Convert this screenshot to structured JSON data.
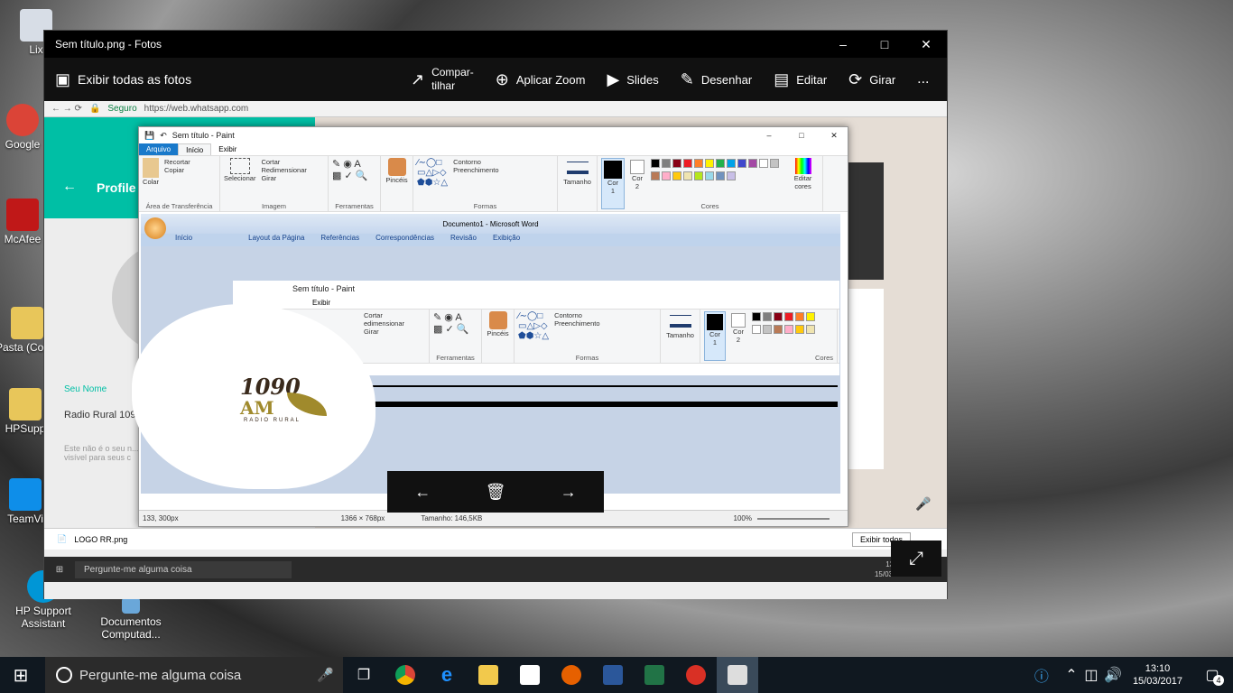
{
  "desktop": {
    "icons": [
      {
        "label": "Lix"
      },
      {
        "label": "Google"
      },
      {
        "label": "McAfee"
      },
      {
        "label": "Pasta (Comp"
      },
      {
        "label": "HPSupp"
      },
      {
        "label": "TeamVi"
      },
      {
        "label": "HP Support Assistant"
      },
      {
        "label": "Documentos Computad..."
      }
    ]
  },
  "photos": {
    "title": "Sem título.png - Fotos",
    "back_label": "Exibir todas as fotos",
    "tools": [
      {
        "label": "Compar-\ntilhar"
      },
      {
        "label": "Aplicar Zoom"
      },
      {
        "label": "Slides"
      },
      {
        "label": "Desenhar"
      },
      {
        "label": "Editar"
      },
      {
        "label": "Girar"
      }
    ],
    "more": "..."
  },
  "image": {
    "chrome": {
      "secure": "Seguro",
      "url": "https://web.whatsapp.com"
    },
    "whatsapp": {
      "header": "Profile",
      "name_label": "Seu Nome",
      "name_value": "Radio Rural 109",
      "note": "Este não é o seu n... visível para seus c"
    },
    "paint": {
      "title": "Sem título - Paint",
      "tabs": [
        "Arquivo",
        "Início",
        "Exibir"
      ],
      "groups": {
        "clipboard": {
          "paste": "Colar",
          "cut": "Recortar",
          "copy": "Copiar",
          "label": "Área de Transferência"
        },
        "image": {
          "select": "Selecionar",
          "crop": "Cortar",
          "resize": "Redimensionar",
          "rotate": "Girar",
          "label": "Imagem"
        },
        "tools": {
          "label": "Ferramentas"
        },
        "brushes": {
          "label": "Pincéis"
        },
        "shapes": {
          "outline": "Contorno",
          "fill": "Preenchimento",
          "label": "Formas"
        },
        "size": {
          "label": "Tamanho"
        },
        "colors": {
          "c1": "Cor\n1",
          "c2": "Cor\n2",
          "edit": "Editar cores",
          "label": "Cores"
        }
      },
      "status": {
        "pos": "133, 300px",
        "dims": "1366 × 768px",
        "size": "Tamanho: 146,5KB",
        "zoom": "100%"
      }
    },
    "word": {
      "title": "Documento1 - Microsoft Word",
      "tabs": [
        "Início",
        "Layout da Página",
        "Referências",
        "Correspondências",
        "Revisão",
        "Exibição"
      ]
    },
    "paint2": {
      "title": "Sem título - Paint",
      "tab": "Exibir",
      "tools_label": "Ferramentas",
      "brushes": "Pincéis",
      "shapes": "Formas",
      "outline": "Contorno",
      "fill": "Preenchimento",
      "size": "Tamanho",
      "c1": "Cor\n1",
      "c2": "Cor\n2",
      "colors": "Cores",
      "crop": "Cortar",
      "resize": "edimensionar",
      "rotate": "Girar"
    },
    "logo": {
      "big": "1090",
      "am": "AM",
      "sub": "RADIO RURAL"
    },
    "download": {
      "file": "LOGO RR.png",
      "show_all": "Exibir todos"
    },
    "inner_task": {
      "search": "Pergunte-me alguma coisa",
      "time": "13:0",
      "date": "15/03/2017"
    }
  },
  "taskbar": {
    "search": "Pergunte-me alguma coisa",
    "time": "13:10",
    "date": "15/03/2017",
    "notifications": "4"
  },
  "palette": [
    "#000000",
    "#7f7f7f",
    "#880015",
    "#ed1c24",
    "#ff7f27",
    "#fff200",
    "#22b14c",
    "#00a2e8",
    "#3f48cc",
    "#a349a4",
    "#ffffff",
    "#c3c3c3",
    "#b97a57",
    "#ffaec9",
    "#ffc90e",
    "#efe4b0",
    "#b5e61d",
    "#99d9ea",
    "#7092be",
    "#c8bfe7"
  ],
  "colors": {
    "whatsapp": "#00bfa5",
    "paint_file_tab": "#1979ca",
    "logo_brown": "#3a2a1c",
    "logo_gold": "#a08a2c"
  }
}
